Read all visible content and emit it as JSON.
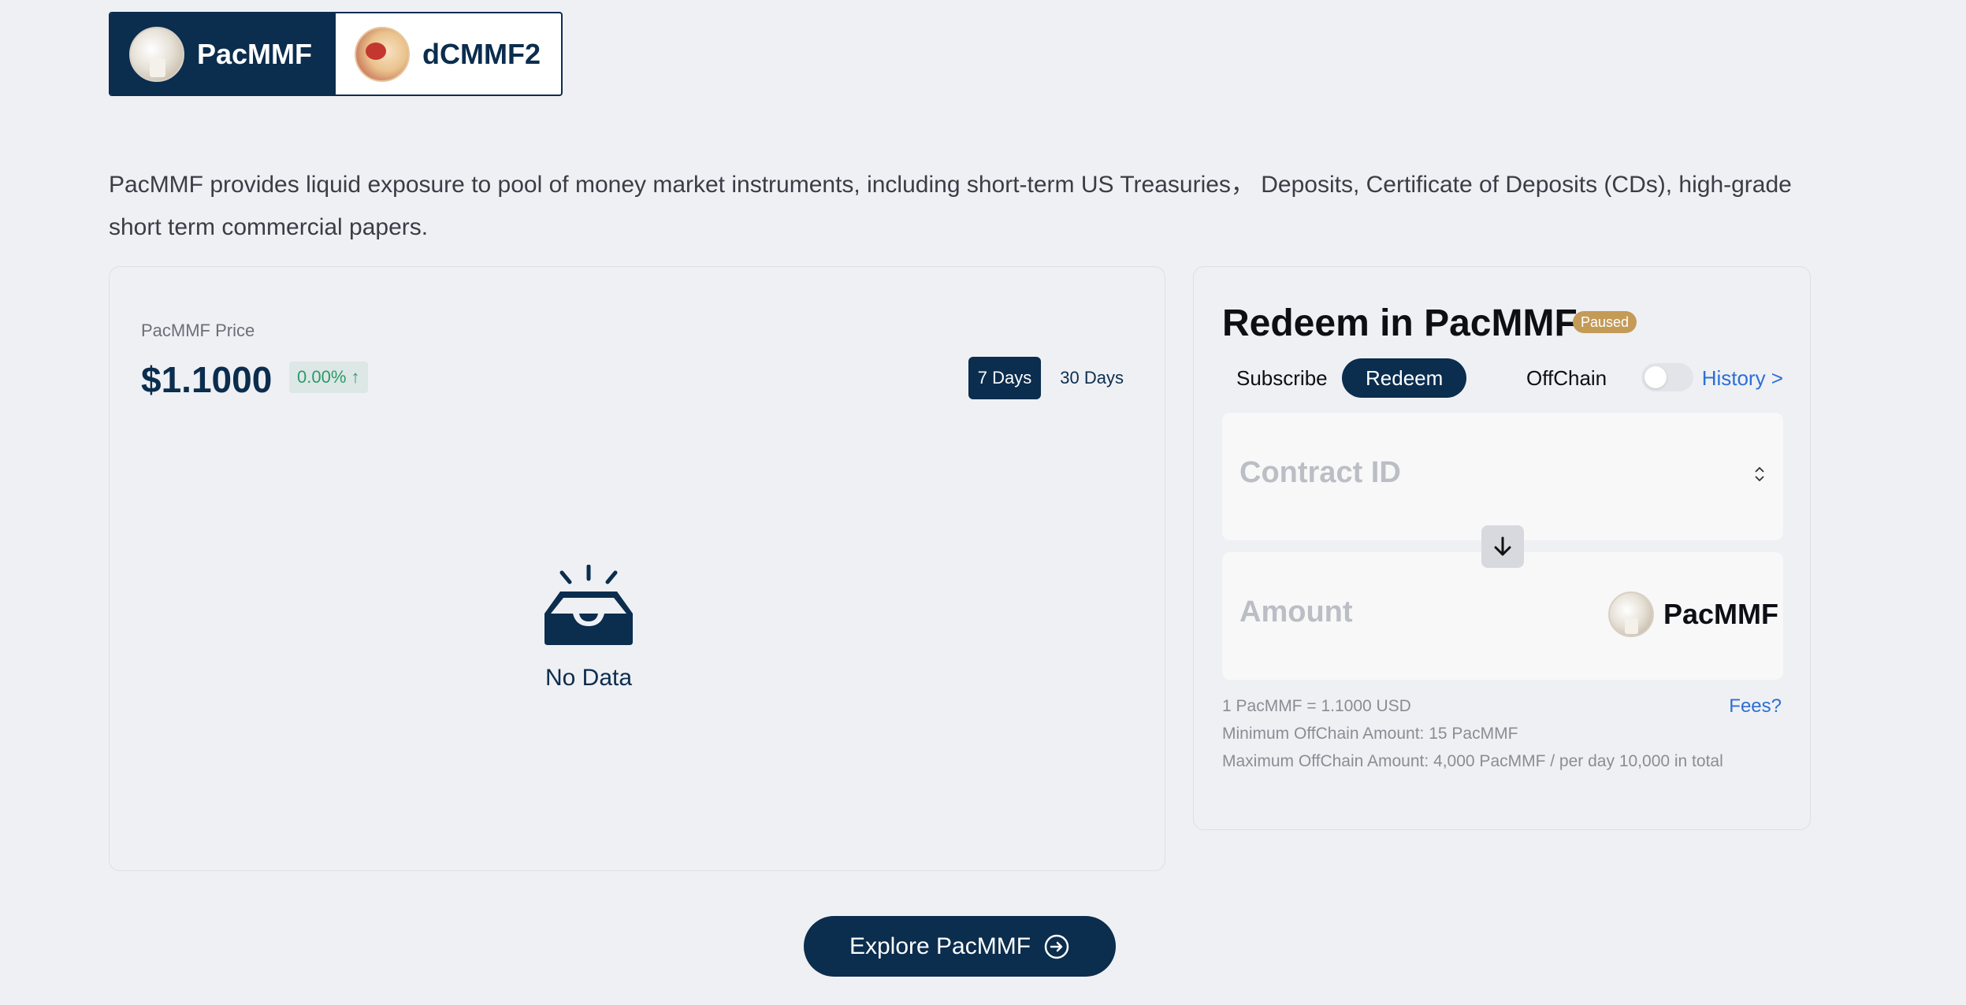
{
  "asset_tabs": [
    {
      "label": "PacMMF",
      "active": true,
      "icon": "pacmmf-avatar"
    },
    {
      "label": "dCMMF2",
      "active": false,
      "icon": "dcmmf2-avatar"
    }
  ],
  "description": "PacMMF provides liquid exposure to pool of money market instruments, including short-term US Treasuries， Deposits, Certificate of Deposits (CDs), high-grade short term commercial papers.",
  "price_card": {
    "label": "PacMMF Price",
    "value": "$1.1000",
    "change": "0.00% ↑",
    "change_color": "#2c9a6a",
    "periods": [
      {
        "label": "7 Days",
        "active": true
      },
      {
        "label": "30 Days",
        "active": false
      }
    ],
    "empty_text": "No Data"
  },
  "redeem_card": {
    "title": "Redeem in PacMMF",
    "status_badge": "Paused",
    "status_color": "#c49a57",
    "modes": {
      "subscribe": "Subscribe",
      "redeem": "Redeem",
      "active": "Redeem"
    },
    "offchain_label": "OffChain",
    "offchain_enabled": false,
    "history_link": "History >",
    "contract_placeholder": "Contract ID",
    "amount_placeholder": "Amount",
    "token": "PacMMF",
    "rate": "1 PacMMF = 1.1000 USD",
    "fees_link": "Fees?",
    "min_amount": "Minimum OffChain Amount: 15 PacMMF",
    "max_amount": "Maximum OffChain Amount: 4,000 PacMMF / per day 10,000 in total"
  },
  "explore_button": "Explore PacMMF",
  "colors": {
    "primary": "#0b2d4e",
    "link": "#2b6fd6",
    "background": "#eff0f4"
  }
}
